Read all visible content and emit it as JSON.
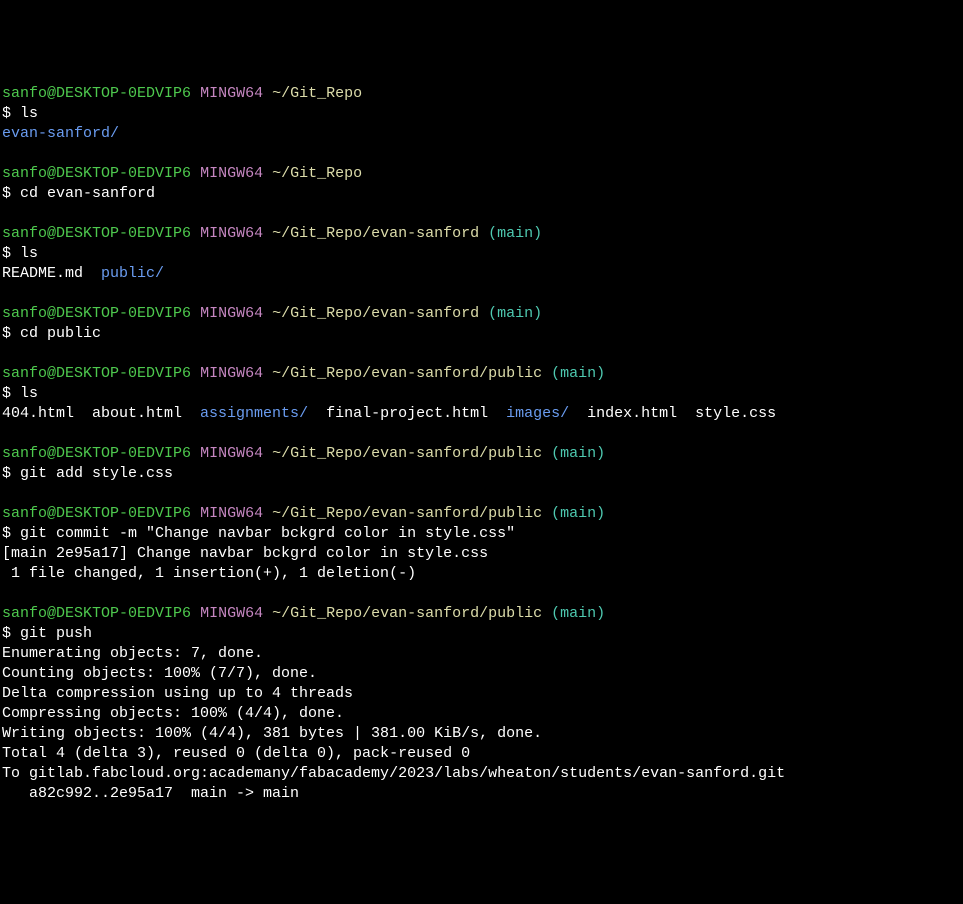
{
  "prompt": {
    "user": "sanfo",
    "at": "@",
    "host": "DESKTOP-0EDVIP6",
    "env": "MINGW64",
    "symbol": "$"
  },
  "blocks": [
    {
      "path": "~/Git_Repo",
      "branch": "",
      "cmd": "ls",
      "output_parts": [
        {
          "text": "evan-sanford/",
          "type": "dir"
        }
      ]
    },
    {
      "path": "~/Git_Repo",
      "branch": "",
      "cmd": "cd evan-sanford",
      "output_parts": []
    },
    {
      "path": "~/Git_Repo/evan-sanford",
      "branch": "(main)",
      "cmd": "ls",
      "output_parts": [
        {
          "text": "README.md  ",
          "type": "file"
        },
        {
          "text": "public/",
          "type": "dir"
        }
      ]
    },
    {
      "path": "~/Git_Repo/evan-sanford",
      "branch": "(main)",
      "cmd": "cd public",
      "output_parts": []
    },
    {
      "path": "~/Git_Repo/evan-sanford/public",
      "branch": "(main)",
      "cmd": "ls",
      "output_parts": [
        {
          "text": "404.html  about.html  ",
          "type": "file"
        },
        {
          "text": "assignments/",
          "type": "dir"
        },
        {
          "text": "  final-project.html  ",
          "type": "file"
        },
        {
          "text": "images/",
          "type": "dir"
        },
        {
          "text": "  index.html  style.css",
          "type": "file"
        }
      ]
    },
    {
      "path": "~/Git_Repo/evan-sanford/public",
      "branch": "(main)",
      "cmd": "git add style.css",
      "output_parts": []
    },
    {
      "path": "~/Git_Repo/evan-sanford/public",
      "branch": "(main)",
      "cmd": "git commit -m \"Change navbar bckgrd color in style.css\"",
      "output_lines": [
        "[main 2e95a17] Change navbar bckgrd color in style.css",
        " 1 file changed, 1 insertion(+), 1 deletion(-)"
      ]
    },
    {
      "path": "~/Git_Repo/evan-sanford/public",
      "branch": "(main)",
      "cmd": "git push",
      "output_lines": [
        "Enumerating objects: 7, done.",
        "Counting objects: 100% (7/7), done.",
        "Delta compression using up to 4 threads",
        "Compressing objects: 100% (4/4), done.",
        "Writing objects: 100% (4/4), 381 bytes | 381.00 KiB/s, done.",
        "Total 4 (delta 3), reused 0 (delta 0), pack-reused 0",
        "To gitlab.fabcloud.org:academany/fabacademy/2023/labs/wheaton/students/evan-sanford.git",
        "   a82c992..2e95a17  main -> main"
      ]
    }
  ]
}
